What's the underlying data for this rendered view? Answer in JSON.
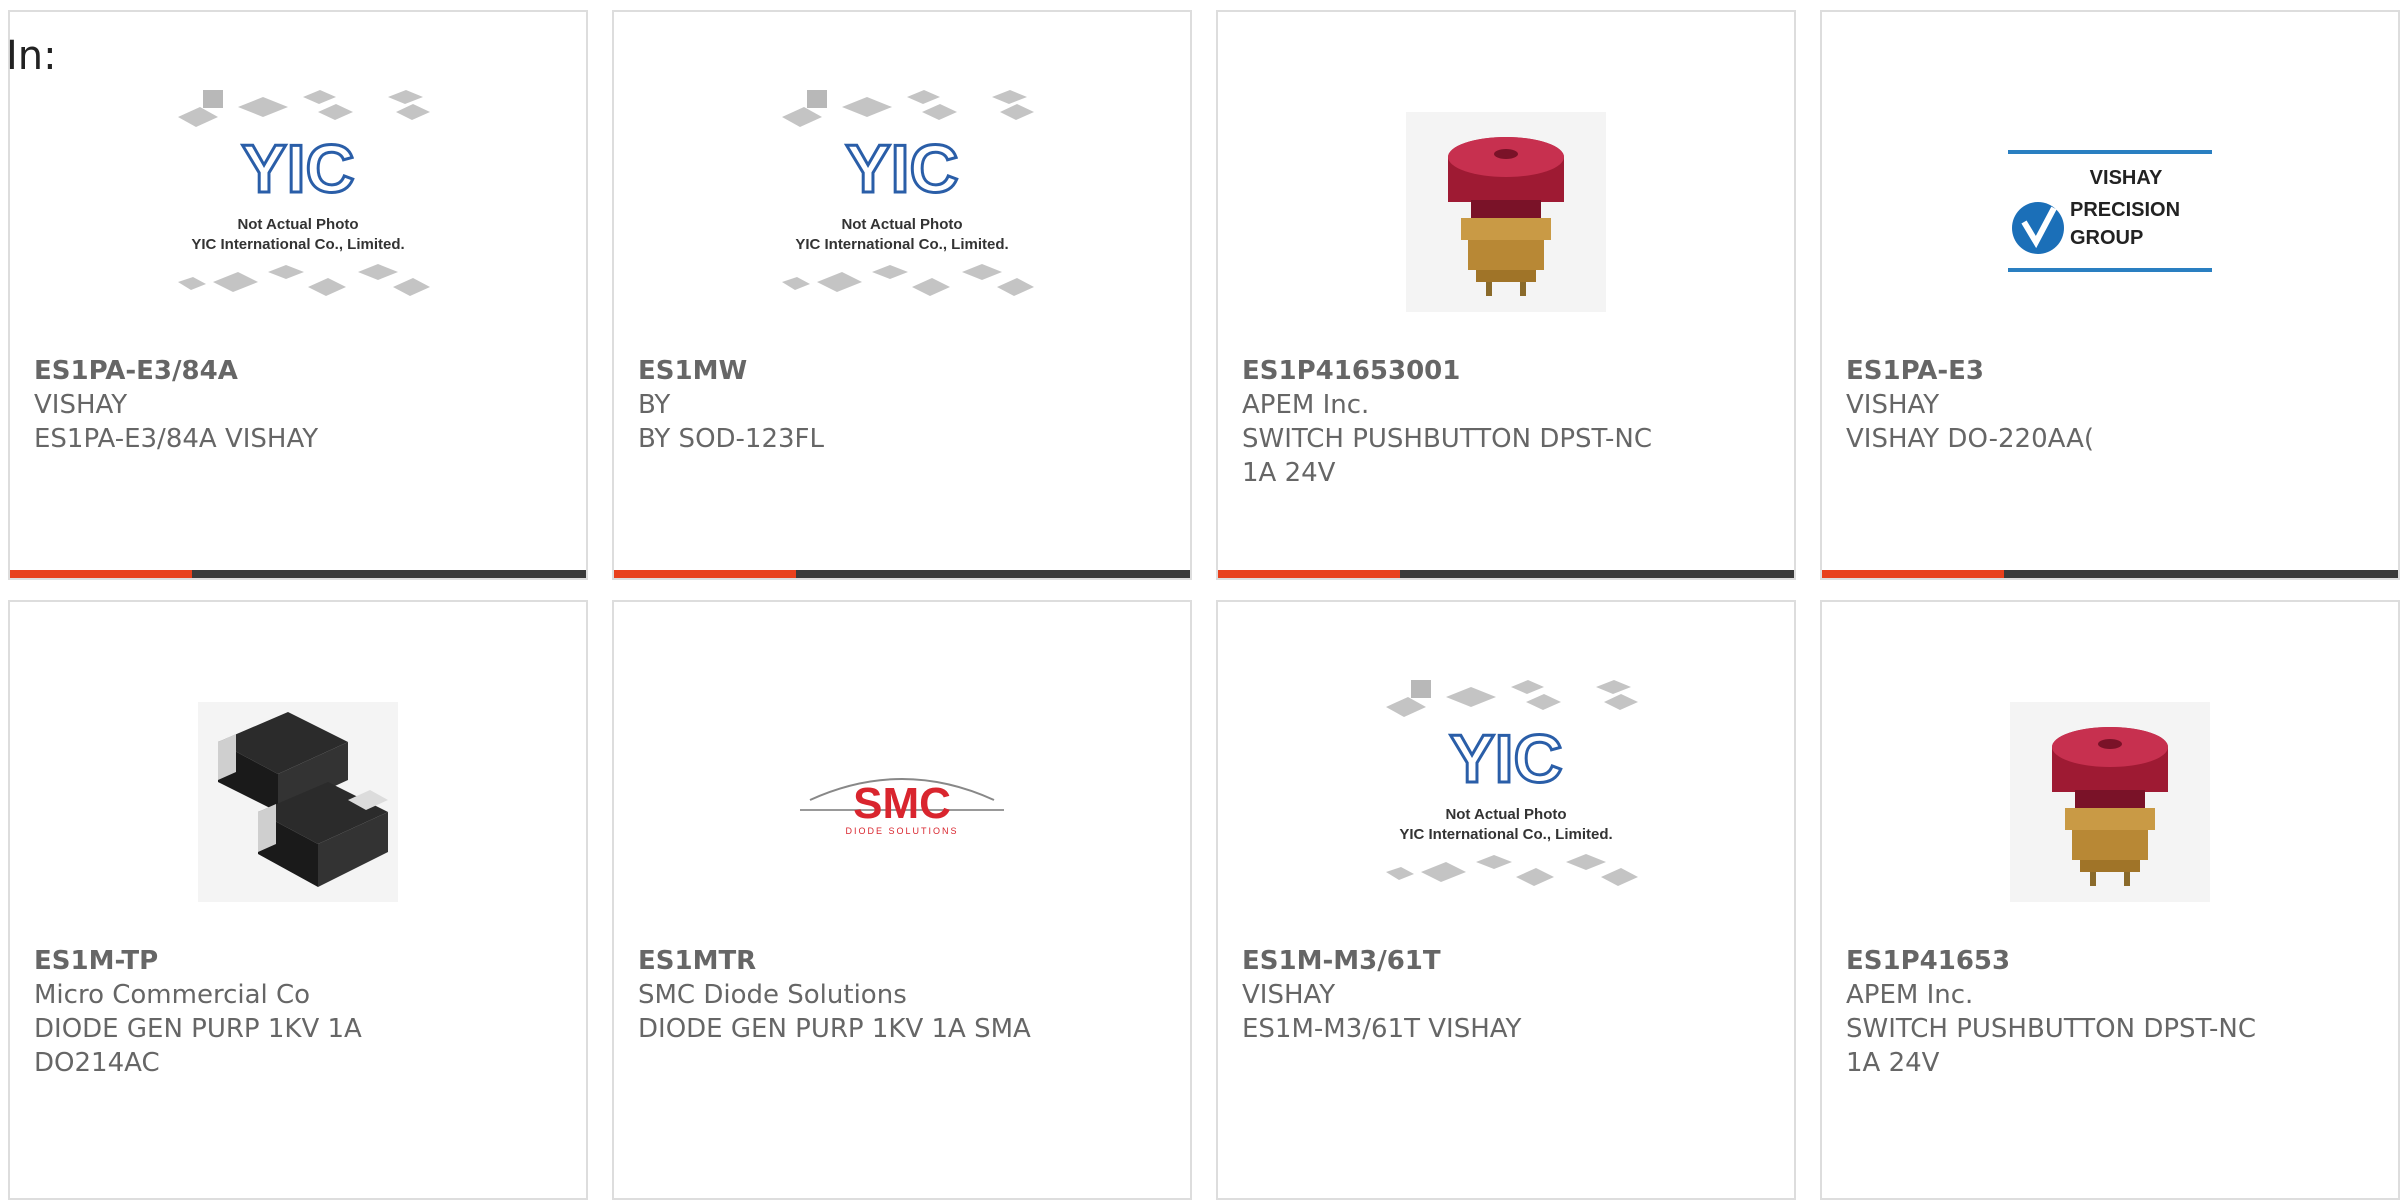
{
  "filter_label": "In:",
  "colors": {
    "accent": "#e8401c",
    "bar": "#3a3a3a",
    "border": "#dddddd",
    "text": "#666666"
  },
  "products": [
    {
      "part": "ES1PA-E3/84A",
      "manufacturer": "VISHAY",
      "description": "ES1PA-E3/84A VISHAY",
      "image": "placeholder-photo",
      "image_text": [
        "Not Actual Photo",
        "YIC International Co., Limited."
      ]
    },
    {
      "part": "ES1MW",
      "manufacturer": "BY",
      "description": "BY SOD-123FL",
      "image": "placeholder-photo",
      "image_text": [
        "Not Actual Photo",
        "YIC International Co., Limited."
      ]
    },
    {
      "part": "ES1P41653001",
      "manufacturer": "APEM Inc.",
      "description": "SWITCH PUSHBUTTON DPST-NC 1A 24V",
      "image": "red-pushbutton"
    },
    {
      "part": "ES1PA-E3",
      "manufacturer": "VISHAY",
      "description": "VISHAY DO-220AA(",
      "image": "vishay-logo",
      "image_text": [
        "VISHAY",
        "PRECISION",
        "GROUP"
      ]
    },
    {
      "part": "ES1M-TP",
      "manufacturer": "Micro Commercial Co",
      "description": "DIODE GEN PURP 1KV 1A DO214AC",
      "image": "smd-diode"
    },
    {
      "part": "ES1MTR",
      "manufacturer": "SMC Diode Solutions",
      "description": "DIODE GEN PURP 1KV 1A SMA",
      "image": "smc-logo",
      "image_text": [
        "SMC",
        "DIODE SOLUTIONS"
      ]
    },
    {
      "part": "ES1M-M3/61T",
      "manufacturer": "VISHAY",
      "description": "ES1M-M3/61T VISHAY",
      "image": "placeholder-photo",
      "image_text": [
        "Not Actual Photo",
        "YIC International Co., Limited."
      ]
    },
    {
      "part": "ES1P41653",
      "manufacturer": "APEM Inc.",
      "description": "SWITCH PUSHBUTTON DPST-NC 1A 24V",
      "image": "red-pushbutton"
    }
  ]
}
